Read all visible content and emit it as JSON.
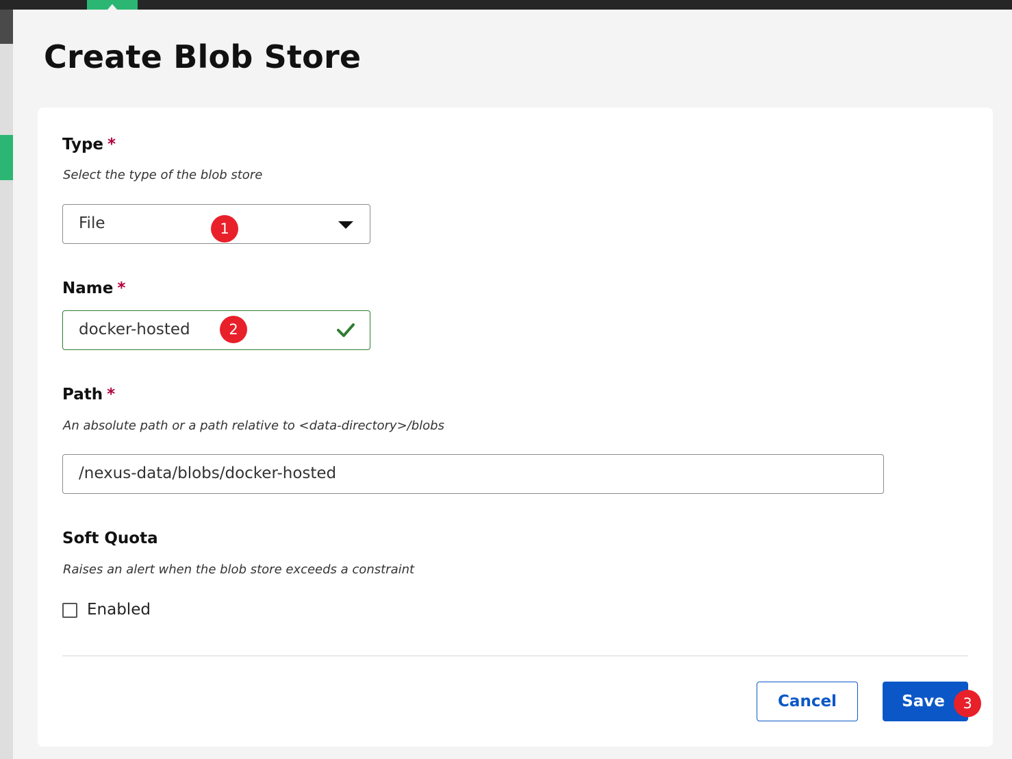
{
  "page": {
    "title": "Create Blob Store"
  },
  "form": {
    "type": {
      "label": "Type",
      "required_mark": "*",
      "description": "Select the type of the blob store",
      "selected": "File"
    },
    "name": {
      "label": "Name",
      "required_mark": "*",
      "value": "docker-hosted",
      "valid": true
    },
    "path": {
      "label": "Path",
      "required_mark": "*",
      "description": "An absolute path or a path relative to <data-directory>/blobs",
      "value": "/nexus-data/blobs/docker-hosted"
    },
    "soft_quota": {
      "label": "Soft Quota",
      "description": "Raises an alert when the blob store exceeds a constraint",
      "enabled_label": "Enabled",
      "enabled": false
    }
  },
  "actions": {
    "cancel_label": "Cancel",
    "save_label": "Save"
  },
  "annotations": {
    "marker_1": "1",
    "marker_2": "2",
    "marker_3": "3"
  },
  "colors": {
    "primary": "#0b57c7",
    "accent_green": "#2bb673",
    "required": "#b3003b",
    "valid": "#2e7d32",
    "marker": "#e8202a"
  },
  "icons": {
    "type_dropdown": "caret-down-icon",
    "name_status": "checkmark-icon"
  }
}
